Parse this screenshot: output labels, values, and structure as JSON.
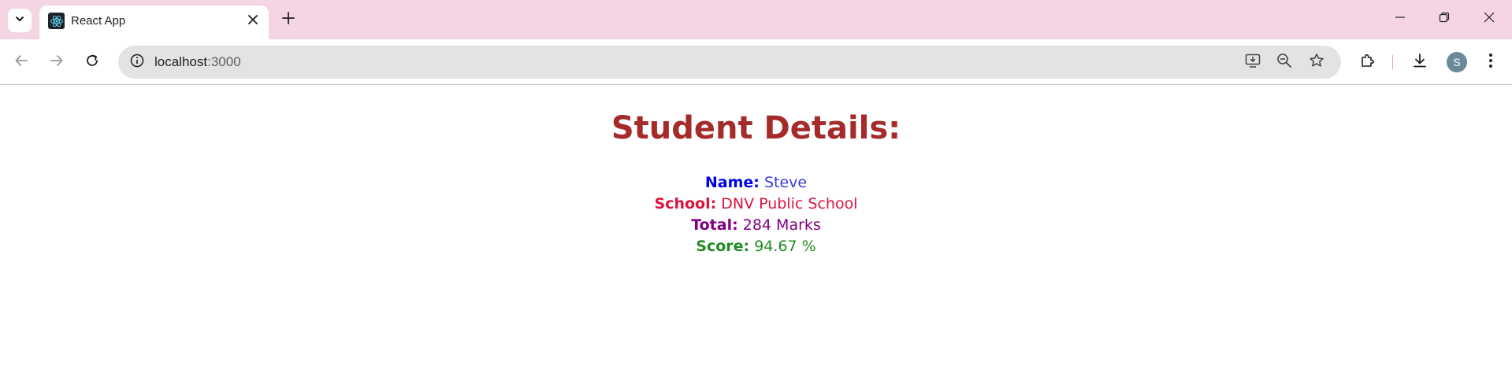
{
  "browser": {
    "tab_title": "React App",
    "url_host": "localhost",
    "url_port": ":3000",
    "profile_initial": "S"
  },
  "page": {
    "heading": "Student Details:",
    "name_label": "Name:",
    "name_value": "Steve",
    "school_label": "School:",
    "school_value": "DNV Public School",
    "total_label": "Total:",
    "total_value": "284 Marks",
    "score_label": "Score:",
    "score_value": "94.67 %"
  },
  "colors": {
    "titlebar": "#f5d4e3",
    "heading": "#a52a2a",
    "name": "#0000ee",
    "school": "#dc143c",
    "total": "#800080",
    "score": "#228b22"
  },
  "icons": [
    "tab-search-icon",
    "react-logo-icon",
    "close-icon",
    "plus-icon",
    "minimize-icon",
    "restore-icon",
    "close-window-icon",
    "back-arrow-icon",
    "forward-arrow-icon",
    "reload-icon",
    "site-info-icon",
    "install-app-icon",
    "zoom-out-icon",
    "star-icon",
    "extensions-icon",
    "download-icon",
    "kebab-menu-icon"
  ]
}
